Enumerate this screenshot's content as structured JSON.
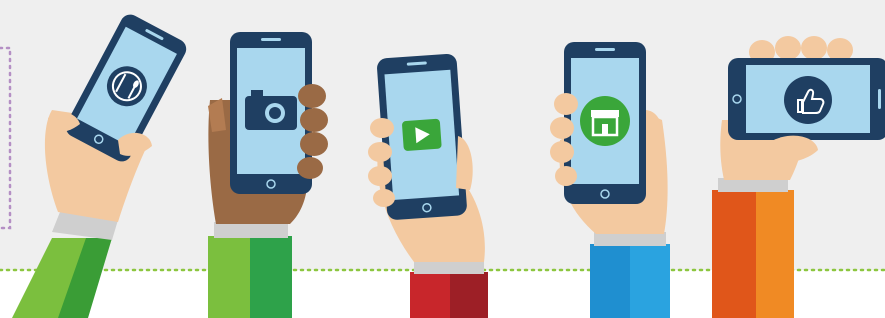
{
  "illustration": {
    "background_color": "#efefef",
    "accent_colors": {
      "dotted_line": "#8cc63f",
      "left_bracket": "#b48fc4",
      "phone_body": "#1f3f62",
      "screen": "#a9d7ee"
    },
    "hands": [
      {
        "skin": "light",
        "sleeve_colors": [
          "#7bbf3e",
          "#3a9d36"
        ],
        "app_icon": "dining-icon",
        "app_icon_color": "#1f3f62"
      },
      {
        "skin": "dark",
        "sleeve_colors": [
          "#7bbf3e",
          "#2ea24a"
        ],
        "app_icon": "camera-icon",
        "app_icon_color": "#1f3f62"
      },
      {
        "skin": "light",
        "sleeve_colors": [
          "#c8262b",
          "#9d1f26"
        ],
        "app_icon": "play-video-icon",
        "app_icon_color": "#3aa63a"
      },
      {
        "skin": "light",
        "sleeve_colors": [
          "#1f8fd0",
          "#2aa3e0"
        ],
        "app_icon": "store-icon",
        "app_icon_color": "#3aa63a"
      },
      {
        "skin": "light",
        "sleeve_colors": [
          "#e0561a",
          "#f08a24"
        ],
        "app_icon": "thumbs-up-icon",
        "app_icon_color": "#1f3f62"
      }
    ]
  }
}
